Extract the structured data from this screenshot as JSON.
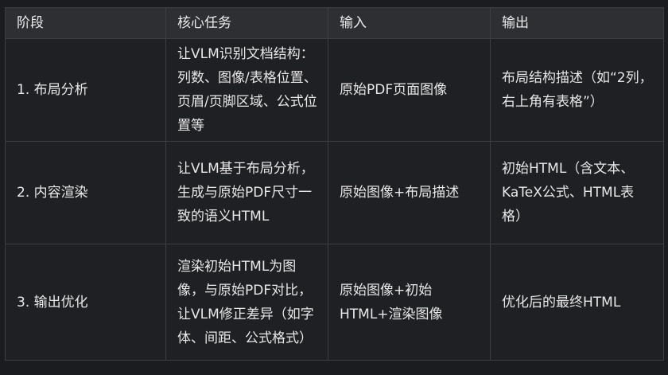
{
  "table": {
    "headers": [
      "阶段",
      "核心任务",
      "输入",
      "输出"
    ],
    "rows": [
      {
        "stage": "1. 布局分析",
        "task": "让VLM识别文档结构：列数、图像/表格位置、页眉/页脚区域、公式位置等",
        "input": "原始PDF页面图像",
        "output": "布局结构描述（如“2列，右上角有表格”）"
      },
      {
        "stage": "2. 内容渲染",
        "task": "让VLM基于布局分析，生成与原始PDF尺寸一致的语义HTML",
        "input": "原始图像+布局描述",
        "output": "初始HTML（含文本、KaTeX公式、HTML表格）"
      },
      {
        "stage": "3. 输出优化",
        "task": "渲染初始HTML为图像，与原始PDF对比，让VLM修正差异（如字体、间距、公式格式）",
        "input": "原始图像+初始HTML+渲染图像",
        "output": "优化后的最终HTML"
      }
    ]
  }
}
